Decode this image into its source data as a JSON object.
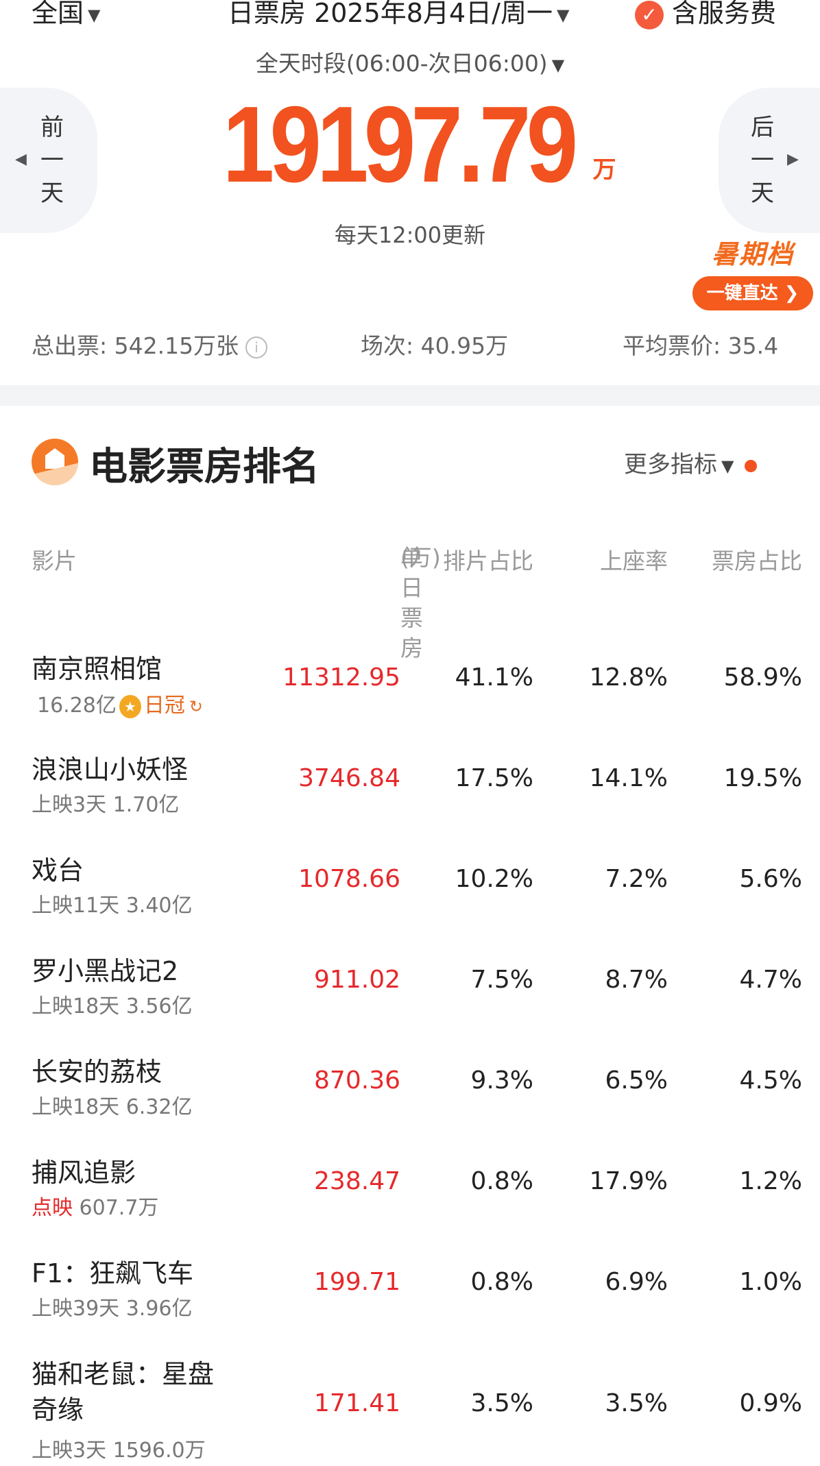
{
  "top": {
    "region": "全国",
    "date_selector": "日票房 2025年8月4日/周一",
    "service_fee": "含服务费",
    "period": "全天时段(06:00-次日06:00)"
  },
  "summary": {
    "prev_day": [
      "前",
      "一",
      "天"
    ],
    "next_day": [
      "后",
      "一",
      "天"
    ],
    "total": "19197.79",
    "unit": "万",
    "update_note": "每天12:00更新",
    "promo_title": "暑期档",
    "promo_button": "一键直达"
  },
  "stats": {
    "tickets": "总出票: 542.15万张",
    "shows": "场次: 40.95万",
    "avg_price": "平均票价: 35.4"
  },
  "ranking": {
    "title": "电影票房排名",
    "more": "更多指标",
    "headers": {
      "film": "影片",
      "box": "单日票房",
      "box_unit": "(万)",
      "schedule": "排片占比",
      "seat": "上座率",
      "share": "票房占比"
    },
    "rows": [
      {
        "name": "南京照相馆",
        "sub": "16.28亿",
        "crown": "日冠",
        "box": "11312.95",
        "schedule": "41.1%",
        "seat": "12.8%",
        "share": "58.9%"
      },
      {
        "name": "浪浪山小妖怪",
        "sub": "上映3天 1.70亿",
        "box": "3746.84",
        "schedule": "17.5%",
        "seat": "14.1%",
        "share": "19.5%"
      },
      {
        "name": "戏台",
        "sub": "上映11天 3.40亿",
        "box": "1078.66",
        "schedule": "10.2%",
        "seat": "7.2%",
        "share": "5.6%"
      },
      {
        "name": "罗小黑战记2",
        "sub": "上映18天 3.56亿",
        "box": "911.02",
        "schedule": "7.5%",
        "seat": "8.7%",
        "share": "4.7%"
      },
      {
        "name": "长安的荔枝",
        "sub": "上映18天 6.32亿",
        "box": "870.36",
        "schedule": "9.3%",
        "seat": "6.5%",
        "share": "4.5%"
      },
      {
        "name": "捕风追影",
        "sub_tag": "点映",
        "sub": "607.7万",
        "box": "238.47",
        "schedule": "0.8%",
        "seat": "17.9%",
        "share": "1.2%"
      },
      {
        "name": "F1：狂飙飞车",
        "sub": "上映39天 3.96亿",
        "box": "199.71",
        "schedule": "0.8%",
        "seat": "6.9%",
        "share": "1.0%"
      },
      {
        "name_line1": "猫和老鼠：星盘",
        "name_line2": "奇缘",
        "sub": "上映3天 1596.0万",
        "box": "171.41",
        "schedule": "3.5%",
        "seat": "3.5%",
        "share": "0.9%"
      }
    ]
  }
}
